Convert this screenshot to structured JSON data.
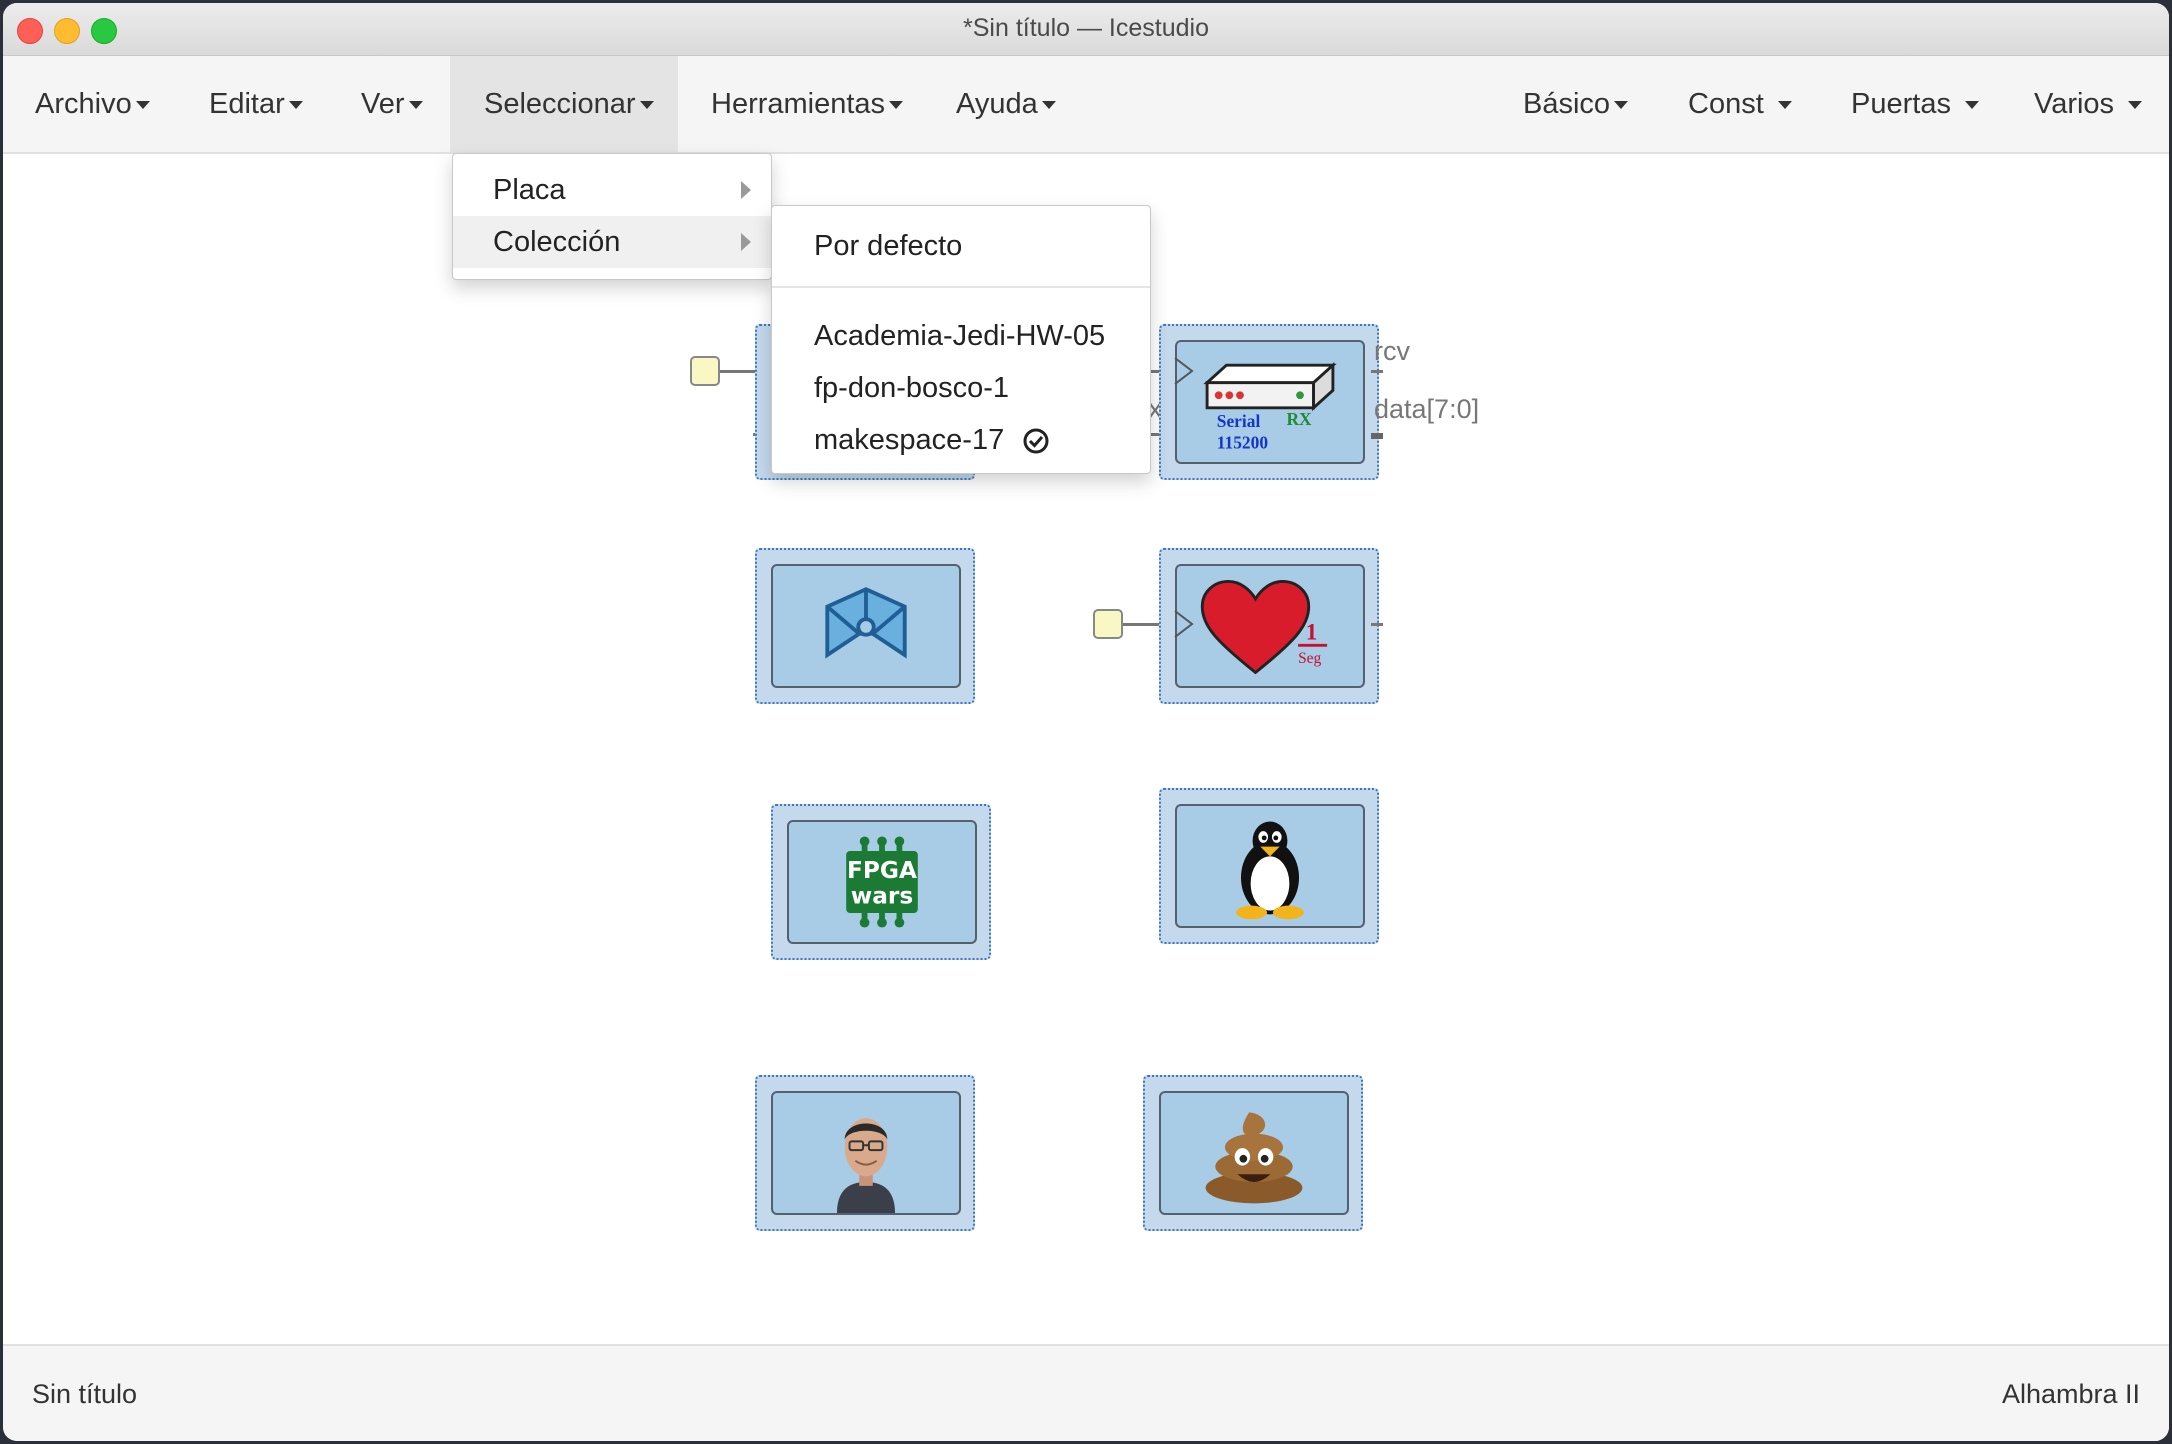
{
  "window": {
    "title": "*Sin título — Icestudio"
  },
  "menu": {
    "left": [
      {
        "label": "Archivo"
      },
      {
        "label": "Editar"
      },
      {
        "label": "Ver"
      },
      {
        "label": "Seleccionar"
      },
      {
        "label": "Herramientas"
      },
      {
        "label": "Ayuda"
      }
    ],
    "right": [
      {
        "label": "Básico"
      },
      {
        "label": "Const"
      },
      {
        "label": "Puertas"
      },
      {
        "label": "Varios"
      }
    ]
  },
  "select_menu": {
    "items": [
      {
        "label": "Placa"
      },
      {
        "label": "Colección"
      }
    ]
  },
  "collection_submenu": {
    "default_label": "Por defecto",
    "items": [
      {
        "label": "Academia-Jedi-HW-05",
        "checked": false
      },
      {
        "label": "fp-don-bosco-1",
        "checked": false
      },
      {
        "label": "makespace-17",
        "checked": true
      }
    ]
  },
  "blocks": {
    "serial": {
      "line1": "Serial",
      "line2": "RX",
      "line3": "115200",
      "port_rcv": "rcv",
      "port_data": "data[7:0]",
      "port_partial": "X"
    },
    "heart": {
      "num": "1",
      "den": "Seg"
    },
    "fpga": {
      "line1": "FPGA",
      "line2": "wars"
    }
  },
  "footer": {
    "file": "Sin título",
    "board": "Alhambra II"
  },
  "colors": {
    "block_fill": "#c4d9ec",
    "block_border": "#3a78c6",
    "port_fill": "#f9f7c3"
  }
}
